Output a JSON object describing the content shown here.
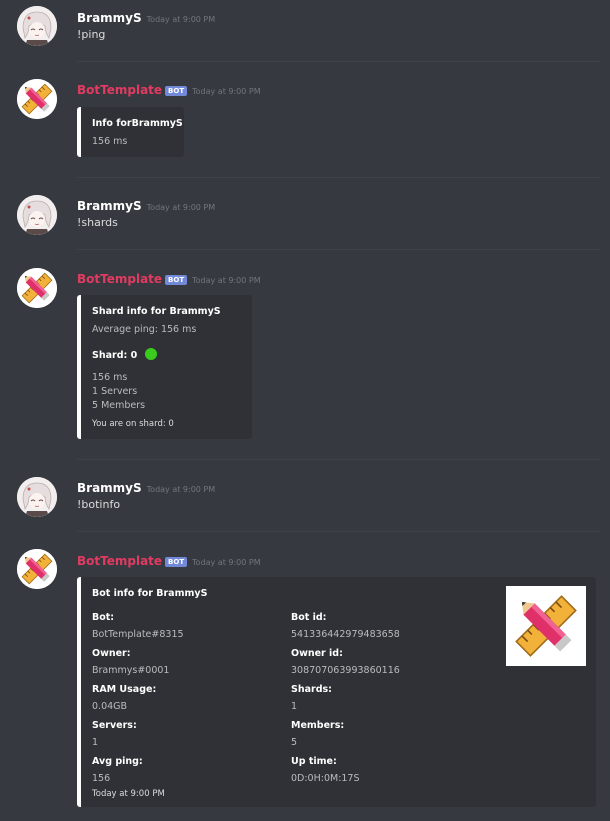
{
  "users": {
    "brammy": {
      "name": "BrammyS"
    },
    "bot": {
      "name": "BotTemplate",
      "badge": "BOT"
    }
  },
  "messages": [
    {
      "author": "BrammyS",
      "time": "Today at 9:00 PM",
      "text": "!ping"
    },
    {
      "author": "BotTemplate",
      "badge": "BOT",
      "time": "Today at 9:00 PM",
      "embed": {
        "title": "Info forBrammyS",
        "description": "156 ms"
      }
    },
    {
      "author": "BrammyS",
      "time": "Today at 9:00 PM",
      "text": "!shards"
    },
    {
      "author": "BotTemplate",
      "badge": "BOT",
      "time": "Today at 9:00 PM",
      "embed": {
        "title": "Shard info for BrammyS",
        "description": "Average ping: 156 ms",
        "field_name": "Shard: 0",
        "field_lines": [
          "156 ms",
          "1 Servers",
          "5 Members"
        ],
        "footer": "You are on shard: 0"
      }
    },
    {
      "author": "BrammyS",
      "time": "Today at 9:00 PM",
      "text": "!botinfo"
    },
    {
      "author": "BotTemplate",
      "badge": "BOT",
      "time": "Today at 9:00 PM",
      "embed": {
        "title": "Bot info for BrammyS",
        "fields": [
          {
            "name": "Bot:",
            "value": "BotTemplate#8315"
          },
          {
            "name": "Bot id:",
            "value": "541336442979483658"
          },
          {
            "name": "Owner:",
            "value": "Brammys#0001"
          },
          {
            "name": "Owner id:",
            "value": "308707063993860116"
          },
          {
            "name": "RAM Usage:",
            "value": "0.04GB"
          },
          {
            "name": "Shards:",
            "value": "1"
          },
          {
            "name": "Servers:",
            "value": "1"
          },
          {
            "name": "Members:",
            "value": "5"
          },
          {
            "name": "Avg ping:",
            "value": "156"
          },
          {
            "name": "Up time:",
            "value": "0D:0H:0M:17S"
          }
        ],
        "footer": "Today at 9:00 PM"
      }
    }
  ],
  "colors": {
    "background": "#36393f",
    "embed_bg": "#2f3136",
    "bot_name": "#e33a62",
    "status_online": "#3acc1d",
    "badge": "#7289da"
  },
  "icons": {
    "bot_avatar": "ruler-pencil-icon",
    "user_avatar": "anime-avatar-icon",
    "shard_status": "online-status-dot"
  }
}
